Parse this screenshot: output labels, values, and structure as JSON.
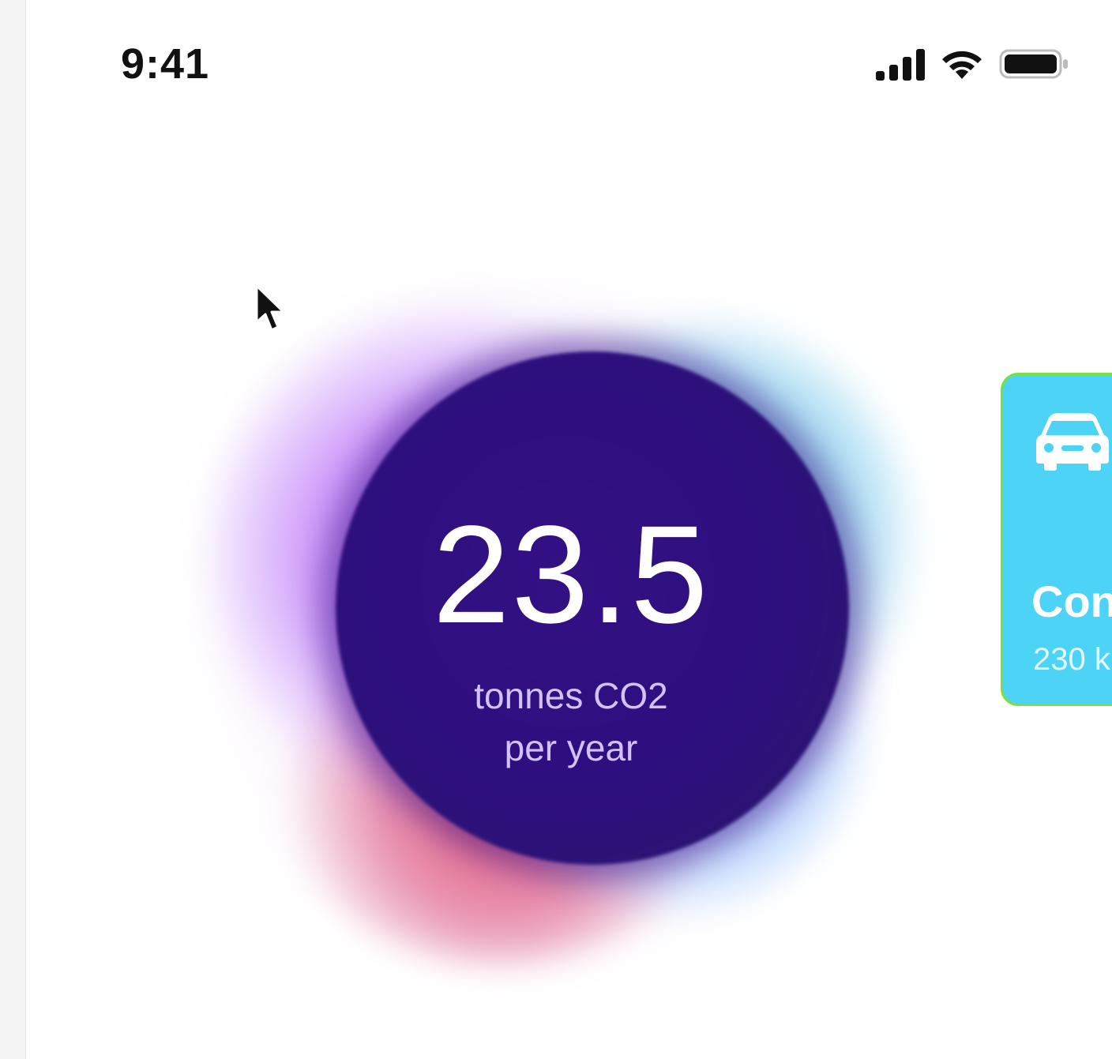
{
  "status_bar": {
    "time": "9:41",
    "icons": [
      "signal-icon",
      "wifi-icon",
      "battery-icon"
    ]
  },
  "footprint": {
    "value": "23.5",
    "unit_line1": "tonnes CO2",
    "unit_line2": "per year"
  },
  "card": {
    "icon": "car-icon",
    "title": "Con",
    "subtitle": "230 k",
    "background_color": "#4dd3f5"
  },
  "colors": {
    "core": "#2e0f7e",
    "caption": "#d4c2ff",
    "glow_purple": "#c86eff",
    "glow_teal": "#6ee1d7",
    "glow_red": "#e6506e"
  }
}
